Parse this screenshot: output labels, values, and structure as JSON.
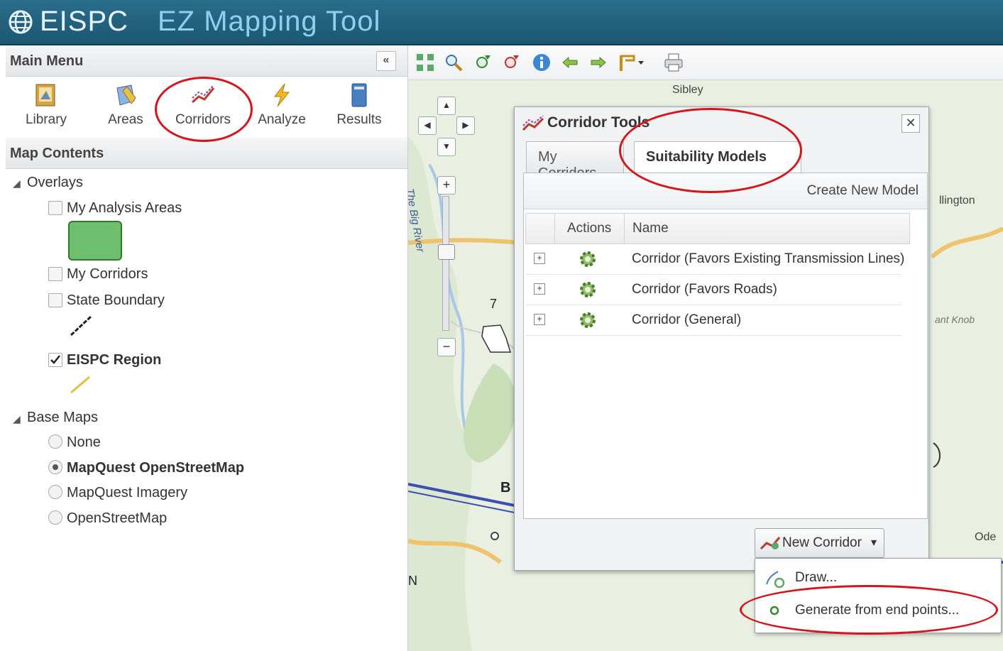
{
  "app": {
    "title_part1": "EISPC",
    "title_part2": "EZ Mapping Tool"
  },
  "main_menu": {
    "header": "Main Menu",
    "collapse_glyph": "«",
    "items": [
      {
        "label": "Library",
        "icon": "library-icon"
      },
      {
        "label": "Areas",
        "icon": "areas-icon"
      },
      {
        "label": "Corridors",
        "icon": "corridors-icon"
      },
      {
        "label": "Analyze",
        "icon": "analyze-icon"
      },
      {
        "label": "Results",
        "icon": "results-icon"
      }
    ]
  },
  "map_contents": {
    "header": "Map Contents",
    "overlays_label": "Overlays",
    "overlays": [
      {
        "label": "My Analysis Areas",
        "checked": false
      },
      {
        "label": "My Corridors",
        "checked": false
      },
      {
        "label": "State Boundary",
        "checked": false
      },
      {
        "label": "EISPC Region",
        "checked": true
      }
    ],
    "basemaps_label": "Base Maps",
    "basemaps": [
      {
        "label": "None",
        "selected": false
      },
      {
        "label": "MapQuest OpenStreetMap",
        "selected": true
      },
      {
        "label": "MapQuest Imagery",
        "selected": false
      },
      {
        "label": "OpenStreetMap",
        "selected": false
      }
    ]
  },
  "map": {
    "labels": {
      "sibley": "Sibley",
      "ellington": "llington",
      "knob": "ant Knob",
      "route": "7",
      "b": "B",
      "n": "N",
      "ode": "Ode",
      "river": "The Big River"
    },
    "nav": {
      "up": "▲",
      "left": "◀",
      "right": "▶",
      "down": "▼",
      "zoom_in": "+",
      "zoom_out": "−"
    }
  },
  "corridor_tools": {
    "title": "Corridor Tools",
    "close_glyph": "✕",
    "tabs": {
      "my_corridors": "My Corridors",
      "suitability_models": "Suitability Models"
    },
    "create_new_model": "Create New Model",
    "columns": {
      "actions": "Actions",
      "name": "Name"
    },
    "expand_glyph": "+",
    "rows": [
      {
        "name": "Corridor (Favors Existing Transmission Lines)"
      },
      {
        "name": "Corridor (Favors Roads)"
      },
      {
        "name": "Corridor (General)"
      }
    ],
    "new_corridor": "New Corridor",
    "new_corridor_caret": "▾",
    "dropdown": {
      "draw": "Draw...",
      "generate": "Generate from end points..."
    }
  },
  "colors": {
    "titlebar": "#1f5e7c",
    "highlight": "#d8141b",
    "analysis_area_swatch": "#6dbf6d"
  }
}
